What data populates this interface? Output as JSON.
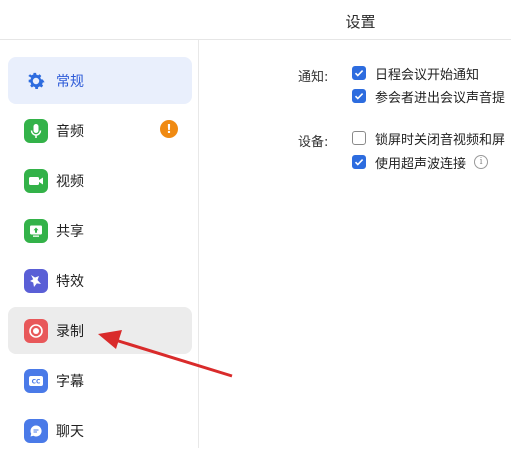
{
  "window": {
    "title": "设置"
  },
  "sidebar": {
    "items": [
      {
        "label": "常规",
        "icon": "gear-icon",
        "color": "#2d6cdf"
      },
      {
        "label": "音频",
        "icon": "microphone-icon",
        "color": "#33b249",
        "badge": "!"
      },
      {
        "label": "视频",
        "icon": "video-camera-icon",
        "color": "#33b249"
      },
      {
        "label": "共享",
        "icon": "share-screen-icon",
        "color": "#33b249"
      },
      {
        "label": "特效",
        "icon": "sparkle-icon",
        "color": "#5a5fd6"
      },
      {
        "label": "录制",
        "icon": "record-icon",
        "color": "#e8585a"
      },
      {
        "label": "字幕",
        "icon": "cc-icon",
        "color": "#4a7ae8"
      },
      {
        "label": "聊天",
        "icon": "chat-icon",
        "color": "#4a7ae8"
      }
    ]
  },
  "main": {
    "notify": {
      "label": "通知:",
      "options": [
        {
          "text": "日程会议开始通知",
          "checked": true
        },
        {
          "text": "参会者进出会议声音提",
          "checked": true
        }
      ]
    },
    "device": {
      "label": "设备:",
      "options": [
        {
          "text": "锁屏时关闭音视频和屏",
          "checked": false
        },
        {
          "text": "使用超声波连接",
          "checked": true,
          "info": "i"
        }
      ]
    }
  },
  "colors": {
    "accent": "#2d6cdf",
    "arrow": "#d92b2b"
  }
}
